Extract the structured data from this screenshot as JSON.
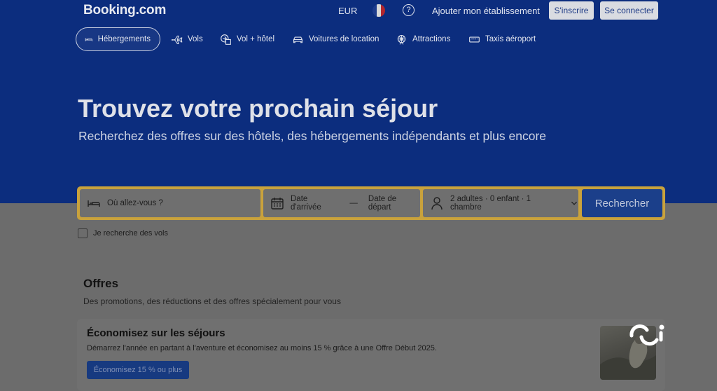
{
  "header": {
    "logo": "Booking.com",
    "currency": "EUR",
    "flag_colors": [
      "#1d3b8c",
      "#d9d9d9",
      "#b3262d"
    ],
    "help_label": "?",
    "list_property": "Ajouter mon établissement",
    "register": "S'inscrire",
    "sign_in": "Se connecter"
  },
  "nav": {
    "items": [
      {
        "label": "Hébergements",
        "icon": "bed-icon",
        "active": true
      },
      {
        "label": "Vols",
        "icon": "plane-icon"
      },
      {
        "label": "Vol + hôtel",
        "icon": "plane-hotel-icon"
      },
      {
        "label": "Voitures de location",
        "icon": "car-icon"
      },
      {
        "label": "Attractions",
        "icon": "attractions-icon"
      },
      {
        "label": "Taxis aéroport",
        "icon": "taxi-icon"
      }
    ]
  },
  "hero": {
    "title": "Trouvez votre prochain séjour",
    "subtitle": "Recherchez des offres sur des hôtels, des hébergements indépendants et plus encore"
  },
  "search": {
    "destination_placeholder": "Où allez-vous ?",
    "checkin": "Date d'arrivée",
    "dash": "—",
    "checkout": "Date de départ",
    "guests": "2 adultes · 0 enfant · 1 chambre",
    "button": "Rechercher"
  },
  "flights_checkbox": "Je recherche des vols",
  "offers": {
    "title": "Offres",
    "subtitle": "Des promotions, des réductions et des offres spécialement pour vous",
    "card": {
      "title": "Économisez sur les séjours",
      "text": "Démarrez l'année en partant à l'aventure et économisez au moins 15 % grâce à une Offre Début 2025.",
      "button": "Économisez 15 % ou plus"
    }
  },
  "colors": {
    "hero_bg": "#0c2d7e",
    "search_border": "#c9a23c",
    "search_button": "#1b3f8a"
  }
}
